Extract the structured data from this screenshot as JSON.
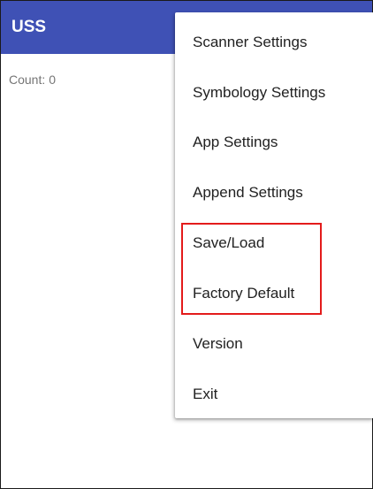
{
  "app_bar": {
    "title": "USS",
    "color": "#3f51b5"
  },
  "status": {
    "count_label": "Count:",
    "count_value": "0"
  },
  "overflow_menu": {
    "items": [
      {
        "label": "Scanner Settings"
      },
      {
        "label": "Symbology Settings"
      },
      {
        "label": "App Settings"
      },
      {
        "label": "Append Settings"
      },
      {
        "label": "Save/Load"
      },
      {
        "label": "Factory Default"
      },
      {
        "label": "Version"
      },
      {
        "label": "Exit"
      }
    ]
  },
  "annotation": {
    "highlight_color": "#e31b1b",
    "highlighted_items": [
      "Save/Load",
      "Factory Default"
    ]
  }
}
